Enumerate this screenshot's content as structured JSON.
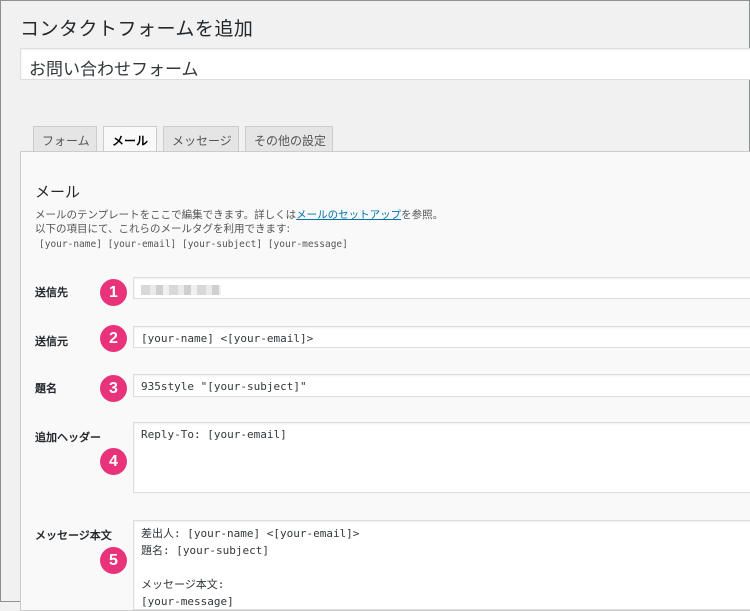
{
  "page": {
    "title": "コンタクトフォームを追加",
    "form_title": "お問い合わせフォーム"
  },
  "tabs": [
    {
      "label": "フォーム",
      "active": false
    },
    {
      "label": "メール",
      "active": true
    },
    {
      "label": "メッセージ",
      "active": false
    },
    {
      "label": "その他の設定",
      "active": false
    }
  ],
  "mail_section": {
    "heading": "メール",
    "desc_before": "メールのテンプレートをここで編集できます。詳しくは",
    "desc_link": "メールのセットアップ",
    "desc_after": "を参照。",
    "desc_line2": "以下の項目にて、これらのメールタグを利用できます:",
    "tags": "[your-name] [your-email] [your-subject] [your-message]"
  },
  "fields": {
    "to": {
      "label": "送信先",
      "badge": "1"
    },
    "from": {
      "label": "送信元",
      "badge": "2",
      "value": "[your-name] <[your-email]>"
    },
    "subject": {
      "label": "題名",
      "badge": "3",
      "value": "935style \"[your-subject]\""
    },
    "headers": {
      "label": "追加ヘッダー",
      "badge": "4",
      "value": "Reply-To: [your-email]"
    },
    "body": {
      "label": "メッセージ本文",
      "badge": "5",
      "lines": [
        "差出人: [your-name] <[your-email]>",
        "題名: [your-subject]",
        "",
        "メッセージ本文:",
        "[your-message]"
      ]
    }
  },
  "colors": {
    "badge": "#e8337a",
    "link": "#0073aa"
  }
}
